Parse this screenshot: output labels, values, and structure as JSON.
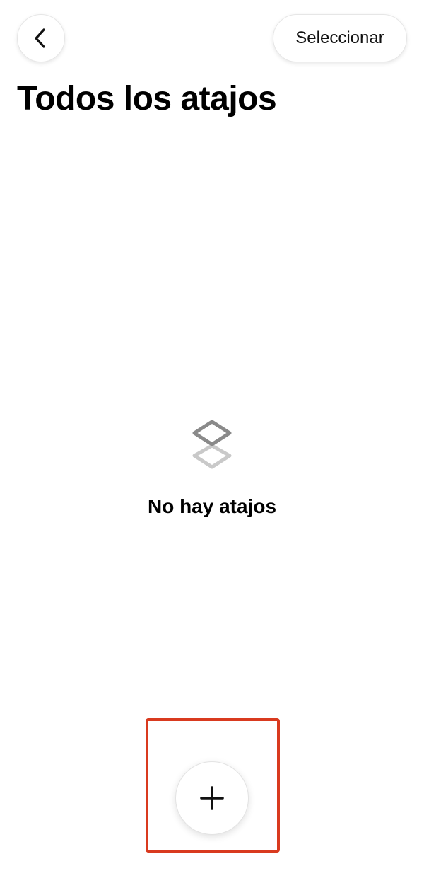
{
  "header": {
    "back_icon": "chevron-left-icon",
    "select_label": "Seleccionar"
  },
  "page": {
    "title": "Todos los atajos"
  },
  "empty_state": {
    "icon": "stacked-shortcuts-icon",
    "message": "No hay atajos"
  },
  "fab": {
    "icon": "plus-icon"
  },
  "colors": {
    "highlight": "#d93a1f",
    "icon_top": "#8a8a8a",
    "icon_bottom": "#c9c9c9"
  }
}
